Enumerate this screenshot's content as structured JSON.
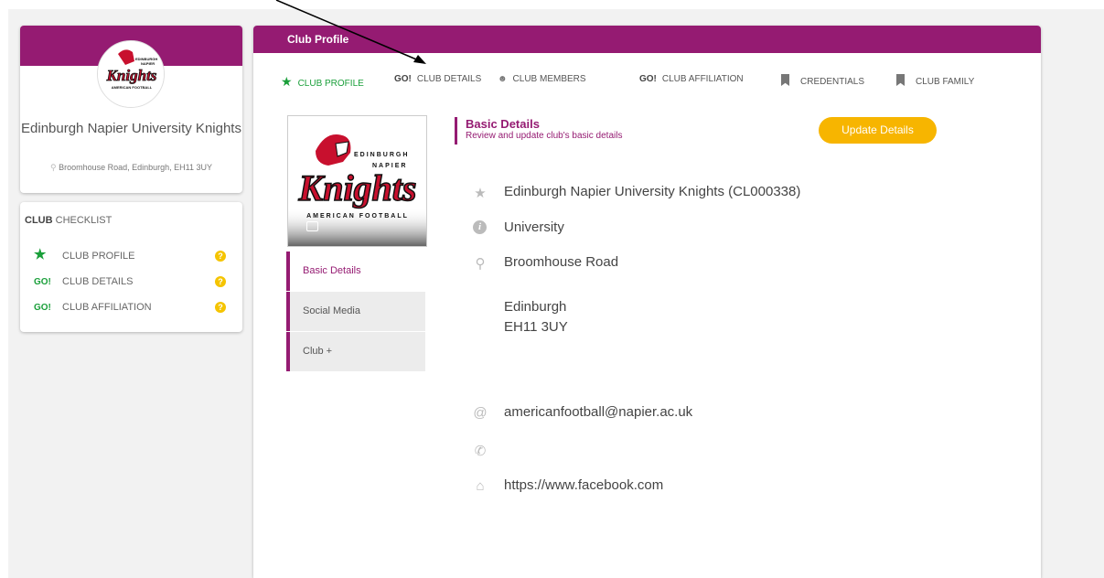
{
  "colors": {
    "brand": "#951b72",
    "accent_green": "#1a9f3a",
    "button": "#f7b500"
  },
  "profile": {
    "name": "Edinburgh Napier University Knights",
    "address": "Broomhouse Road, Edinburgh, EH11 3UY"
  },
  "checklist": {
    "title_bold": "CLUB",
    "title_rest": " CHECKLIST",
    "items": [
      {
        "icon": "star-icon",
        "label": "CLUB PROFILE"
      },
      {
        "icon": "go-icon",
        "label": "CLUB DETAILS"
      },
      {
        "icon": "go-icon",
        "label": "CLUB AFFILIATION"
      }
    ]
  },
  "main": {
    "title": "Club Profile",
    "tabs": [
      {
        "icon": "star-icon",
        "label": "CLUB PROFILE"
      },
      {
        "icon": "go-icon",
        "label": "CLUB DETAILS"
      },
      {
        "icon": "members-icon",
        "label": "CLUB MEMBERS"
      },
      {
        "icon": "go-icon",
        "label": "CLUB AFFILIATION"
      },
      {
        "icon": "bookmark-icon",
        "label": "CREDENTIALS"
      },
      {
        "icon": "bookmark-icon",
        "label": "CLUB FAMILY"
      }
    ],
    "go_text": "GO!",
    "side_nav": [
      "Basic Details",
      "Social Media",
      "Club +"
    ],
    "section_title": "Basic Details",
    "section_subtitle": "Review and update club's basic details",
    "update_button": "Update Details",
    "details": {
      "name": "Edinburgh Napier University Knights (CL000338)",
      "type": "University",
      "address_line": "Broomhouse Road",
      "city": "Edinburgh",
      "postcode": "EH11 3UY",
      "email": "americanfootball@napier.ac.uk",
      "phone": "",
      "website": "https://www.facebook.com"
    }
  },
  "logo_text": {
    "line1": "EDINBURGH",
    "line2": "NAPIER",
    "line3": "Knights",
    "line4": "AMERICAN FOOTBALL"
  }
}
